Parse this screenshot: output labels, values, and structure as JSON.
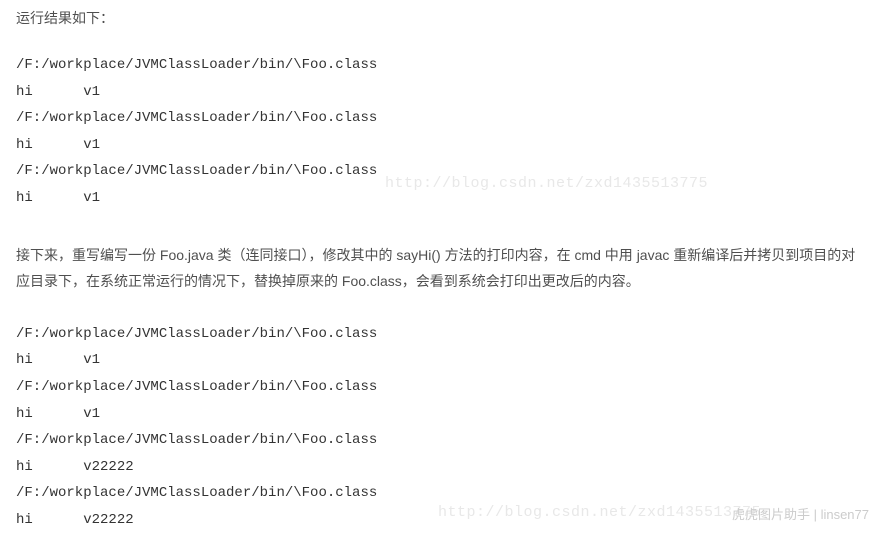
{
  "intro": "运行结果如下：",
  "code1": "/F:/workplace/JVMClassLoader/bin/\\Foo.class\nhi      v1\n/F:/workplace/JVMClassLoader/bin/\\Foo.class\nhi      v1\n/F:/workplace/JVMClassLoader/bin/\\Foo.class\nhi      v1",
  "paragraph": "接下来，重写编写一份 Foo.java 类（连同接口），修改其中的 sayHi() 方法的打印内容，在 cmd 中用 javac 重新编译后并拷贝到项目的对应目录下，在系统正常运行的情况下，替换掉原来的 Foo.class，会看到系统会打印出更改后的内容。",
  "code2": "/F:/workplace/JVMClassLoader/bin/\\Foo.class\nhi      v1\n/F:/workplace/JVMClassLoader/bin/\\Foo.class\nhi      v1\n/F:/workplace/JVMClassLoader/bin/\\Foo.class\nhi      v22222\n/F:/workplace/JVMClassLoader/bin/\\Foo.class\nhi      v22222",
  "watermark1": "http://blog.csdn.net/zxd1435513775",
  "watermark2": "http://blog.csdn.net/zxd1435513775",
  "attribution": "虎虎图片助手 | linsen77"
}
